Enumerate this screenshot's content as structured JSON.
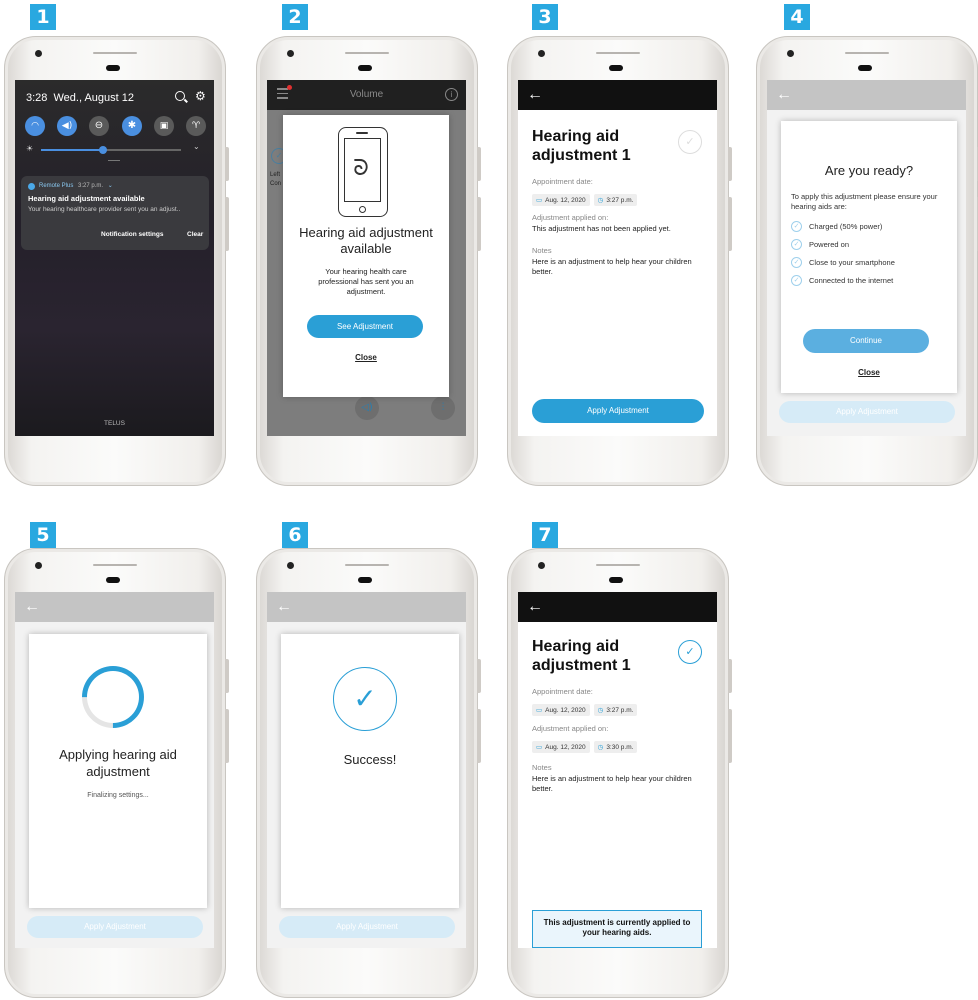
{
  "steps": [
    "1",
    "2",
    "3",
    "4",
    "5",
    "6",
    "7"
  ],
  "s1": {
    "time": "3:28",
    "date": "Wed., August 12",
    "app_name": "Remote Plus",
    "notif_time": "3:27 p.m.",
    "notif_title": "Hearing aid adjustment available",
    "notif_body": "Your hearing healthcare provider sent you an adjust..",
    "notif_settings": "Notification settings",
    "notif_clear": "Clear",
    "carrier": "TELUS"
  },
  "s2": {
    "header_title": "Volume",
    "dialog_title": "Hearing aid adjustment available",
    "dialog_body": "Your hearing health care professional has sent you an adjustment.",
    "see_button": "See Adjustment",
    "close_link": "Close",
    "bg_text_1": "Left",
    "bg_text_2": "Con"
  },
  "s3": {
    "title": "Hearing aid adjustment 1",
    "appt_label": "Appointment date:",
    "appt_date": "Aug. 12, 2020",
    "appt_time": "3:27 p.m.",
    "applied_label": "Adjustment applied on:",
    "applied_value": "This adjustment has not been applied yet.",
    "notes_label": "Notes",
    "notes_value": "Here is an adjustment to help hear your children better.",
    "apply_button": "Apply Adjustment"
  },
  "s4": {
    "title": "Are you ready?",
    "intro": "To apply this adjustment please ensure your hearing aids are:",
    "items": [
      "Charged (50% power)",
      "Powered on",
      "Close to your smartphone",
      "Connected to the internet"
    ],
    "continue_button": "Continue",
    "close_link": "Close",
    "apply_button": "Apply Adjustment"
  },
  "s5": {
    "title": "Applying hearing aid adjustment",
    "status": "Finalizing settings...",
    "apply_button": "Apply Adjustment"
  },
  "s6": {
    "title": "Success!",
    "apply_button": "Apply Adjustment"
  },
  "s7": {
    "title": "Hearing aid adjustment 1",
    "appt_label": "Appointment date:",
    "appt_date": "Aug. 12, 2020",
    "appt_time": "3:27 p.m.",
    "applied_label": "Adjustment applied on:",
    "applied_date": "Aug. 12, 2020",
    "applied_time": "3:30 p.m.",
    "notes_label": "Notes",
    "notes_value": "Here is an adjustment to help hear your children better.",
    "banner": "This adjustment is currently applied to your hearing aids."
  },
  "colors": {
    "accent": "#29a8e0",
    "button": "#2a9fd6",
    "button_light": "#d6ebf7",
    "dark_bar": "#111111",
    "grey_bar": "#c4c4c4"
  }
}
